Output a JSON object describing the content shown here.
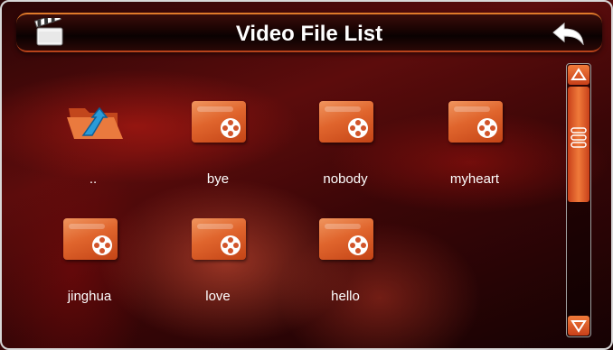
{
  "header": {
    "title": "Video File List",
    "left_icon": "clapperboard-icon",
    "right_icon": "back-arrow-icon"
  },
  "files": [
    {
      "label": "..",
      "icon": "folder-up-icon",
      "kind": "parent"
    },
    {
      "label": "bye",
      "icon": "video-file-icon",
      "kind": "video"
    },
    {
      "label": "nobody",
      "icon": "video-file-icon",
      "kind": "video"
    },
    {
      "label": "myheart",
      "icon": "video-file-icon",
      "kind": "video"
    },
    {
      "label": "jinghua",
      "icon": "video-file-icon",
      "kind": "video"
    },
    {
      "label": "love",
      "icon": "video-file-icon",
      "kind": "video"
    },
    {
      "label": "hello",
      "icon": "video-file-icon",
      "kind": "video"
    }
  ],
  "scrollbar": {
    "up_icon": "scroll-up-arrow-icon",
    "down_icon": "scroll-down-arrow-icon"
  },
  "colors": {
    "accent": "#e0652d",
    "title_text": "#ffffff",
    "background": "#3a0607"
  }
}
